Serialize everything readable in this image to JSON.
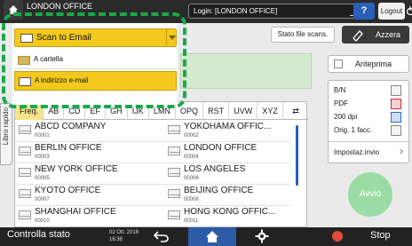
{
  "header": {
    "title": "LONDON OFFICE",
    "login": "Login: [LONDON OFFICE]",
    "help_label": "?",
    "logout_label": "Logout"
  },
  "toolbar": {
    "stato_file_label": "Stato file scans.",
    "azzera_label": "Azzera"
  },
  "dropdown": {
    "selected": "Scan to Email",
    "options": [
      "A cartella",
      "A indirizzo e-mail"
    ]
  },
  "side_tab": {
    "label": "Libro rapido"
  },
  "tabs": [
    "Freq.",
    "AB",
    "CD",
    "EF",
    "GH",
    "IJK",
    "LMN",
    "OPQ",
    "RST",
    "UVW",
    "XYZ"
  ],
  "entries": [
    {
      "name": "ABCD COMPANY",
      "num": "00001"
    },
    {
      "name": "YOKOHAMA OFFIC...",
      "num": "00002"
    },
    {
      "name": "BERLIN OFFICE",
      "num": "00003"
    },
    {
      "name": "LONDON OFFICE",
      "num": "00004"
    },
    {
      "name": "NEW YORK OFFICE",
      "num": "00005"
    },
    {
      "name": "LOS ANGELES",
      "num": "00006"
    },
    {
      "name": "KYOTO OFFICE",
      "num": "00007"
    },
    {
      "name": "BEIJING OFFICE",
      "num": "00008"
    },
    {
      "name": "SHANGHAI OFFICE",
      "num": "00010"
    },
    {
      "name": "HONG KONG OFFIC...",
      "num": "00011"
    }
  ],
  "preview_panel": {
    "anteprima_label": "Anteprima",
    "settings": [
      "B/N",
      "PDF",
      "200 dpi",
      "Orig. 1 facc."
    ],
    "impostaz_label": "Impostaz.invio",
    "avvio_label": "Avvio"
  },
  "bottom_bar": {
    "controlla_label": "Controlla stato",
    "date": "02 Ott. 2018",
    "time": "16:38",
    "stop_label": "Stop"
  },
  "colors": {
    "accent_yellow": "#f2c91c",
    "highlight_green": "#1aa84a",
    "home_blue": "#2c5ba8"
  }
}
